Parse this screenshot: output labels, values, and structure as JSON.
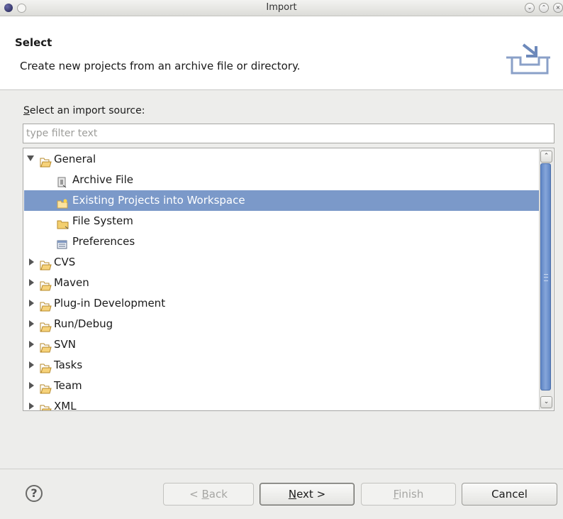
{
  "window": {
    "title": "Import"
  },
  "header": {
    "title": "Select",
    "description": "Create new projects from an archive file or directory."
  },
  "source": {
    "label_mnemonic": "S",
    "label_rest": "elect an import source:",
    "filter_placeholder": "type filter text"
  },
  "tree": {
    "items": [
      {
        "label": "General",
        "level": 0,
        "expanded": true,
        "icon": "folder-open-icon"
      },
      {
        "label": "Archive File",
        "level": 1,
        "icon": "archive-file-icon"
      },
      {
        "label": "Existing Projects into Workspace",
        "level": 1,
        "icon": "existing-project-icon",
        "selected": true
      },
      {
        "label": "File System",
        "level": 1,
        "icon": "folder-icon"
      },
      {
        "label": "Preferences",
        "level": 1,
        "icon": "preferences-icon"
      },
      {
        "label": "CVS",
        "level": 0,
        "expanded": false,
        "icon": "folder-open-icon"
      },
      {
        "label": "Maven",
        "level": 0,
        "expanded": false,
        "icon": "folder-open-icon"
      },
      {
        "label": "Plug-in Development",
        "level": 0,
        "expanded": false,
        "icon": "folder-open-icon"
      },
      {
        "label": "Run/Debug",
        "level": 0,
        "expanded": false,
        "icon": "folder-open-icon"
      },
      {
        "label": "SVN",
        "level": 0,
        "expanded": false,
        "icon": "folder-open-icon"
      },
      {
        "label": "Tasks",
        "level": 0,
        "expanded": false,
        "icon": "folder-open-icon"
      },
      {
        "label": "Team",
        "level": 0,
        "expanded": false,
        "icon": "folder-open-icon"
      },
      {
        "label": "XML",
        "level": 0,
        "expanded": false,
        "icon": "folder-open-icon"
      }
    ]
  },
  "footer": {
    "help_glyph": "?",
    "back": {
      "prefix": "< ",
      "mnemonic": "B",
      "rest": "ack",
      "enabled": false
    },
    "next": {
      "mnemonic": "N",
      "rest": "ext >",
      "enabled": true
    },
    "finish": {
      "mnemonic": "F",
      "rest": "inish",
      "enabled": false
    },
    "cancel": {
      "label": "Cancel",
      "enabled": true
    }
  },
  "colors": {
    "selection": "#7b99c9",
    "scroll_thumb": "#6e92cc",
    "folder": "#e8b74a"
  }
}
